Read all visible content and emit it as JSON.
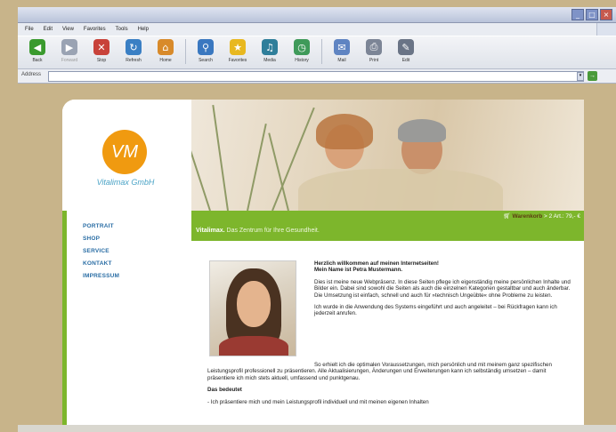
{
  "browser": {
    "menu": [
      "File",
      "Edit",
      "View",
      "Favorites",
      "Tools",
      "Help"
    ],
    "toolbar": [
      {
        "label": "Back",
        "icon": "back-arrow-icon",
        "color": "#3a9a2e",
        "glyph": "◀"
      },
      {
        "label": "Forward",
        "icon": "forward-arrow-icon",
        "color": "#9aa3b3",
        "glyph": "▶"
      },
      {
        "label": "Stop",
        "icon": "stop-icon",
        "color": "#c8423a",
        "glyph": "✕"
      },
      {
        "label": "Refresh",
        "icon": "refresh-icon",
        "color": "#3a7fc4",
        "glyph": "↻"
      },
      {
        "label": "Home",
        "icon": "home-icon",
        "color": "#d88a2a",
        "glyph": "⌂"
      },
      {
        "label": "Search",
        "icon": "search-icon",
        "color": "#3a78c0",
        "glyph": "⚲"
      },
      {
        "label": "Favorites",
        "icon": "star-icon",
        "color": "#e8b820",
        "glyph": "★"
      },
      {
        "label": "Media",
        "icon": "media-icon",
        "color": "#2f7e9a",
        "glyph": "♫"
      },
      {
        "label": "History",
        "icon": "history-icon",
        "color": "#3f9a5a",
        "glyph": "◷"
      },
      {
        "label": "Mail",
        "icon": "mail-icon",
        "color": "#5f84c2",
        "glyph": "✉"
      },
      {
        "label": "Print",
        "icon": "print-icon",
        "color": "#7c8596",
        "glyph": "⎙"
      },
      {
        "label": "Edit",
        "icon": "edit-icon",
        "color": "#6a7486",
        "glyph": "✎"
      }
    ],
    "address_label": "Address",
    "address_value": ""
  },
  "site": {
    "logo_text": "VM",
    "company": "Vitalimax GmbH",
    "nav": [
      "PORTRAIT",
      "SHOP",
      "SERVICE",
      "KONTAKT",
      "IMPRESSUM"
    ],
    "cart_label": "Warenkorb",
    "cart_info": "> 2 Art.: 79,- €",
    "tagline_bold": "Vitalimax.",
    "tagline_rest": "Das Zentrum für Ihre Gesundheit.",
    "welcome_line1": "Herzlich willkommen auf meinen Internetseiten!",
    "welcome_line2": "Mein Name ist Petra Mustermann.",
    "para1": "Dies ist meine neue Webpräsenz. In diese Seiten pflege ich eigenständig meine persönlichen Inhalte und Bilder ein. Dabei sind sowohl die Seiten als auch die einzelnen Kategorien gestaltbar und auch änderbar. Die Umsetzung ist einfach, schnell und auch für »technisch Ungeübte« ohne Probleme zu leisten.",
    "para2": "Ich wurde in die Anwendung des Systems eingeführt und auch angeleitet – bei Rückfragen kann ich jederzeit anrufen.",
    "para3": "So erhielt ich die optimalen Voraussetzungen, mich persönlich und mit meinem ganz spezifischen Leistungsprofil professionell zu präsentieren. Alle Aktualisierungen, Änderungen und Erweiterungen kann ich selbständig umsetzen – damit präsentiere ich mich stets aktuell, umfassend und punktgenau.",
    "heading2": "Das bedeutet",
    "bullet1": "-   Ich präsentiere mich und mein Leistungsprofil individuell und mit meinen eigenen Inhalten"
  }
}
